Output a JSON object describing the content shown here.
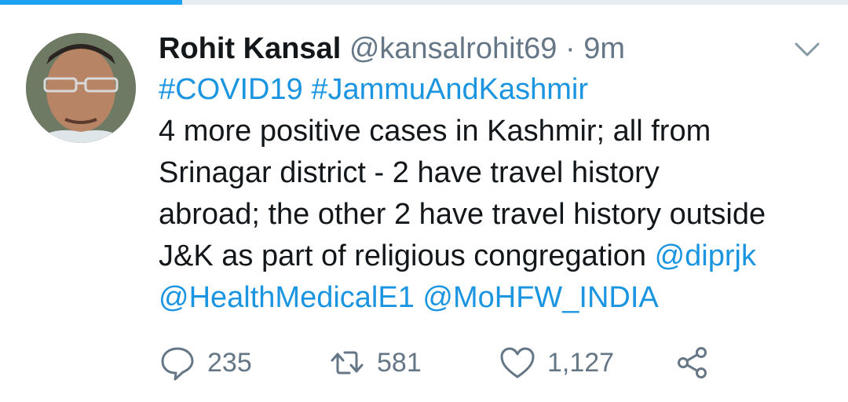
{
  "progress": 0.215,
  "colors": {
    "accent": "#1b95e0",
    "text": "#14171a",
    "muted": "#657786"
  },
  "tweet": {
    "author": {
      "name": "Rohit Kansal",
      "handle": "@kansalrohit69"
    },
    "separator": "·",
    "time": "9m",
    "menu_icon": "chevron-down-icon",
    "hashtags": [
      "#COVID19",
      "#JammuAndKashmir"
    ],
    "lines": [
      "4 more positive cases in Kashmir; all from",
      "Srinagar district - 2 have travel history",
      "abroad; the other 2 have travel history outside",
      "J&K as part of religious congregation"
    ],
    "mentions": [
      "@diprjk",
      "@HealthMedicalE1",
      "@MoHFW_INDIA"
    ]
  },
  "actions": [
    {
      "icon": "reply-icon",
      "count": "235"
    },
    {
      "icon": "retweet-icon",
      "count": "581"
    },
    {
      "icon": "like-icon",
      "count": "1,127"
    },
    {
      "icon": "share-icon"
    }
  ]
}
